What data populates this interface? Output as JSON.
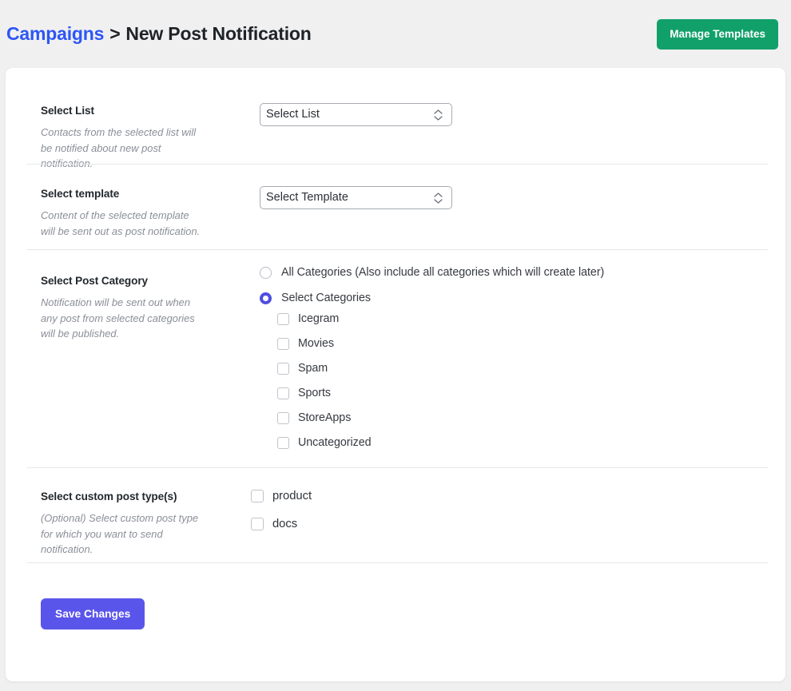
{
  "header": {
    "breadcrumb": {
      "parent": "Campaigns",
      "separator": ">",
      "current": "New Post Notification"
    },
    "manage_templates_label": "Manage Templates",
    "manage_templates_color": "#12a06a"
  },
  "sections": {
    "select_list": {
      "title": "Select List",
      "description": "Contacts from the selected list will be notified about new post notification.",
      "select_value": "Select List",
      "options": [
        "Select List"
      ]
    },
    "select_template": {
      "title": "Select template",
      "description": "Content of the selected template will be sent out as post notification.",
      "select_value": "Select Template",
      "options": [
        "Select Template"
      ]
    },
    "post_category": {
      "title": "Select Post Category",
      "description": "Notification will be sent out when any post from selected categories will be published.",
      "radios": [
        {
          "label": "All Categories (Also include all categories which will create later)",
          "checked": false
        },
        {
          "label": "Select Categories",
          "checked": true
        }
      ],
      "selected_radio_color": "#4e4ee0",
      "categories": [
        {
          "label": "Icegram",
          "checked": false
        },
        {
          "label": "Movies",
          "checked": false
        },
        {
          "label": "Spam",
          "checked": false
        },
        {
          "label": "Sports",
          "checked": false
        },
        {
          "label": "StoreApps",
          "checked": false
        },
        {
          "label": "Uncategorized",
          "checked": false
        }
      ]
    },
    "custom_post_types": {
      "title": "Select custom post type(s)",
      "description": "(Optional) Select custom post type for which you want to send notification.",
      "types": [
        {
          "label": "product",
          "checked": false
        },
        {
          "label": "docs",
          "checked": false
        }
      ]
    }
  },
  "footer": {
    "save_label": "Save Changes",
    "save_color": "#5a55ea"
  },
  "icons": {
    "select_chevron_up": "chevron-up-icon",
    "select_chevron_down": "chevron-down-icon"
  }
}
